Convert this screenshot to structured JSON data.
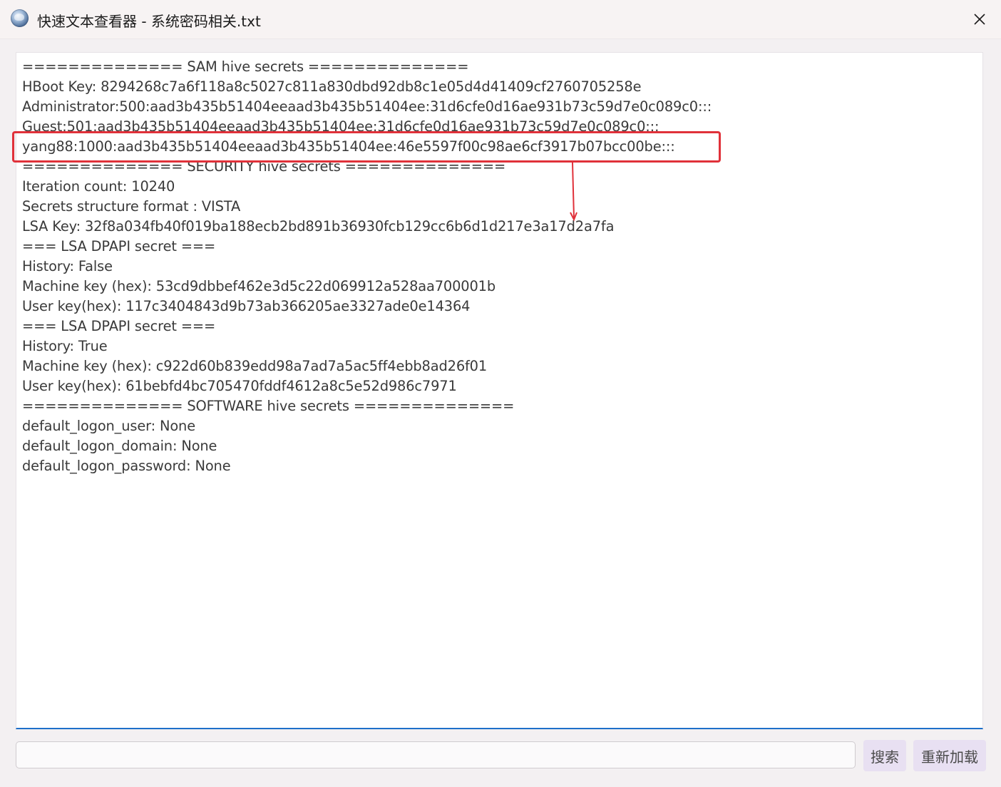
{
  "window": {
    "title": "快速文本查看器 - 系统密码相关.txt",
    "icon": "globe-app-icon",
    "close_icon": "close-icon"
  },
  "content": {
    "lines": [
      "============== SAM hive secrets ==============",
      "HBoot Key: 8294268c7a6f118a8c5027c811a830dbd92db8c1e05d4d41409cf2760705258e",
      "Administrator:500:aad3b435b51404eeaad3b435b51404ee:31d6cfe0d16ae931b73c59d7e0c089c0:::",
      "Guest:501:aad3b435b51404eeaad3b435b51404ee:31d6cfe0d16ae931b73c59d7e0c089c0:::",
      "yang88:1000:aad3b435b51404eeaad3b435b51404ee:46e5597f00c98ae6cf3917b07bcc00be:::",
      "============== SECURITY hive secrets ==============",
      "Iteration count: 10240",
      "Secrets structure format : VISTA",
      "LSA Key: 32f8a034fb40f019ba188ecb2bd891b36930fcb129cc6b6d1d217e3a17d2a7fa",
      "=== LSA DPAPI secret ===",
      "History: False",
      "Machine key (hex): 53cd9dbbef462e3d5c22d069912a528aa700001b",
      "User key(hex): 117c3404843d9b73ab366205ae3327ade0e14364",
      "=== LSA DPAPI secret ===",
      "History: True",
      "Machine key (hex): c922d60b839edd98a7ad7a5ac5ff4ebb8ad26f01",
      "User key(hex): 61bebfd4bc705470fddf4612a8c5e52d986c7971",
      "============== SOFTWARE hive secrets ==============",
      "default_logon_user: None",
      "default_logon_domain: None",
      "default_logon_password: None"
    ],
    "highlighted_line_index": 4
  },
  "annotation": {
    "color": "#e0313a"
  },
  "footer": {
    "search_value": "",
    "search_placeholder": "",
    "search_button": "搜索",
    "reload_button": "重新加载"
  },
  "colors": {
    "accent": "#1e6fc9",
    "button_bg": "#e8e0f2"
  }
}
